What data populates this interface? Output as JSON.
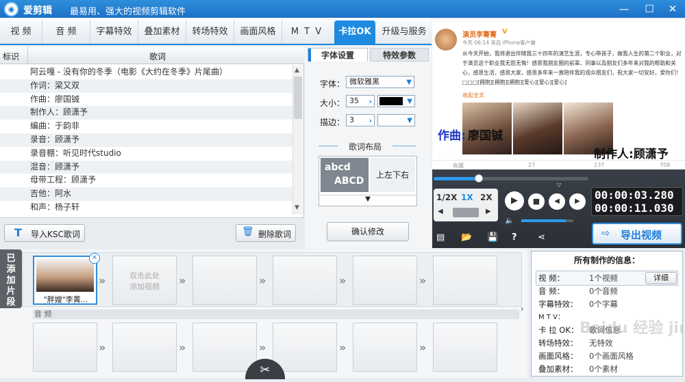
{
  "app": {
    "name": "爱剪辑",
    "slogan": "最易用、强大的视频剪辑软件",
    "logo_glyph": "◉"
  },
  "window_controls": {
    "minimize": "—",
    "maximize": "☐",
    "close": "✕"
  },
  "tabs": [
    "视 频",
    "音 频",
    "字幕特效",
    "叠加素材",
    "转场特效",
    "画面风格",
    "M T V",
    "卡拉OK",
    "升级与服务"
  ],
  "active_tab": "卡拉OK",
  "lyrics": {
    "col_mark": "标识",
    "col_lyric": "歌词",
    "rows": [
      "阿云嘎  -  没有你的冬季（电影《大约在冬季》片尾曲）",
      "作词：梁又双",
      "作曲：廖国铖",
      "制作人：顾潇予",
      "编曲：于韵非",
      "录音：顾潇予",
      "录音棚：听见时代studio",
      "混音：顾潇予",
      "母带工程：顾潇予",
      "吉他：阿水",
      "和声：杨子轩"
    ],
    "import_button": "导入KSC歌词",
    "delete_button": "删除歌词"
  },
  "font_settings": {
    "tab_font": "字体设置",
    "tab_effect": "特效参数",
    "font_label": "字体：",
    "font_value": "微软雅黑",
    "size_label": "大小：",
    "size_value": "35",
    "color_value": "#000000",
    "stroke_label": "描边：",
    "stroke_value": "3",
    "layout_title": "歌词布局",
    "layout_sample_line1": "abcd",
    "layout_sample_line2": "ABCD",
    "layout_option": "上左下右",
    "confirm_button": "确认修改"
  },
  "preview": {
    "username": "演员李菁菁",
    "verified_icon": "V",
    "meta": "今天 06:14 来自 iPhone客户端",
    "post": "从今天开始，我将退出伴随我三十四年的演艺生涯，专心带孩子，做我人生的第二个职业，对于演员这个职业我无怨无悔！感恩我朋友圈的前辈、同事以及朋友们多年来对我的帮助和关心，感恩生活，感恩大家，感恩多年来一直陪伴我的观众朋友们，祝大家一切安好，爱你们！□□□[拥抱][拥抱][拥抱][爱心][爱心][爱心]",
    "fold": "收起全文",
    "subtitle_left_label": "作曲:",
    "subtitle_left_value": "廖国铖",
    "subtitle_right": "制作人:顾潇予",
    "stats": [
      "收藏",
      "27",
      "237",
      "708"
    ]
  },
  "player": {
    "speeds": [
      "1/2X",
      "1X",
      "2X"
    ],
    "active_speed": "1X",
    "progress": 0.29,
    "volume": 0.85,
    "current_time": "00:00:03.280",
    "total_time": "00:00:11.030",
    "export_button": "导出视频"
  },
  "timeline": {
    "side_label": "已添加片段",
    "clip_label": "\"胖嫂\"李菁...",
    "add_hint_line1": "双击此处",
    "add_hint_line2": "添加视频",
    "audio_label": "音 频"
  },
  "info": {
    "title": "所有制作的信息：",
    "detail_button": "详细",
    "rows": [
      {
        "k": "视    频：",
        "v": "1个视频"
      },
      {
        "k": "音    频：",
        "v": "0个音频"
      },
      {
        "k": "字幕特效：",
        "v": "0个字幕"
      },
      {
        "k": "M  T  V：",
        "v": ""
      },
      {
        "k": "卡 拉 OK：",
        "v": "歌词信息"
      },
      {
        "k": "转场特效：",
        "v": "无特效"
      },
      {
        "k": "画面风格：",
        "v": "0个画面风格"
      },
      {
        "k": "叠加素材：",
        "v": "0个素材"
      }
    ]
  },
  "watermark": "Baidu 经验 jingyan.baidu.com"
}
